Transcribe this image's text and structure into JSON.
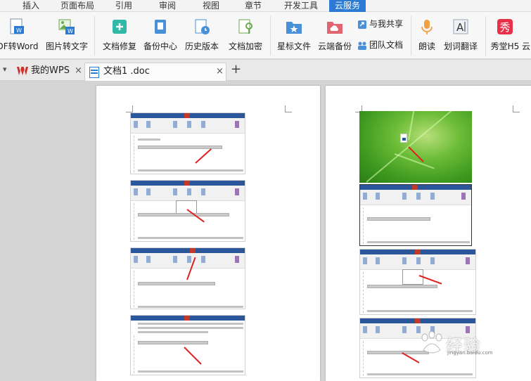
{
  "menu": {
    "tabs": [
      "插入",
      "页面布局",
      "引用",
      "审阅",
      "视图",
      "章节",
      "开发工具",
      "云服务"
    ],
    "active": "云服务"
  },
  "ribbon": {
    "pdf_to_word": "DF转Word",
    "image_to_text": "图片转文字",
    "doc_repair": "文档修复",
    "backup_center": "备份中心",
    "history_version": "历史版本",
    "doc_encrypt": "文档加密",
    "star_file": "星标文件",
    "cloud_backup": "云端备份",
    "shared_with_me": "与我共享",
    "team_docs": "团队文档",
    "read_aloud": "朗读",
    "word_translate": "划词翻译",
    "xiutang": "秀堂H5",
    "cloud_more": "云",
    "xiu_glyph": "秀"
  },
  "tabs": {
    "home": "我的WPS",
    "doc": "文档1 .doc",
    "close": "×",
    "add": "+",
    "dropdown": "▾"
  },
  "colors": {
    "accent": "#2b7bd4",
    "wps_red": "#d0302c",
    "word_blue": "#2b579a"
  },
  "watermark": {
    "text": "经验",
    "sub": "jingyan.baidu.com"
  }
}
